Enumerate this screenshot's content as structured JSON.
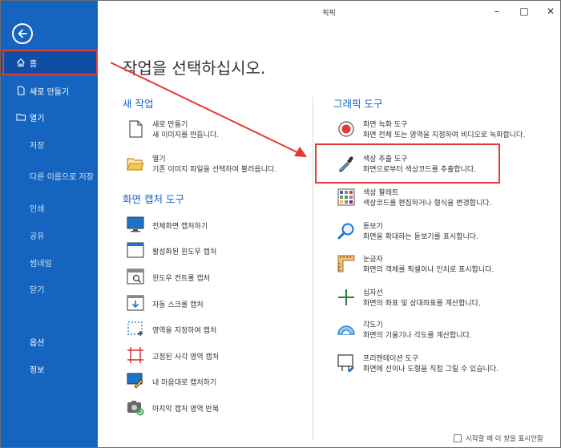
{
  "window": {
    "title": "픽픽",
    "minimize": "–",
    "maximize": "□",
    "close": "✕"
  },
  "sidebar": {
    "items": [
      {
        "label": "홈"
      },
      {
        "label": "새로 만들기"
      },
      {
        "label": "열기"
      },
      {
        "label": "저장"
      },
      {
        "label": "다른 이름으로 저장"
      },
      {
        "label": "인쇄"
      },
      {
        "label": "공유"
      },
      {
        "label": "썸네일"
      },
      {
        "label": "닫기"
      },
      {
        "label": "옵션"
      },
      {
        "label": "정보"
      }
    ]
  },
  "main": {
    "heading": "작업을 선택하십시오.",
    "new_task": {
      "title": "새 작업",
      "items": [
        {
          "title": "새로 만들기",
          "desc": "새 이미지를 만듭니다."
        },
        {
          "title": "열기",
          "desc": "기존 이미지 파일을 선택하여 불러옵니다."
        }
      ]
    },
    "capture": {
      "title": "화면 캡처 도구",
      "items": [
        {
          "title": "전체화면 캡처하기"
        },
        {
          "title": "활성화된 윈도우 캡처"
        },
        {
          "title": "윈도우 컨트롤 캡처"
        },
        {
          "title": "자동 스크롤 캡처"
        },
        {
          "title": "영역을 지정하여 캡처"
        },
        {
          "title": "고정된 사각 영역 캡처"
        },
        {
          "title": "내 마음대로 캡처하기"
        },
        {
          "title": "마지막 캡처 영역 반복"
        }
      ]
    },
    "graphic": {
      "title": "그래픽 도구",
      "items": [
        {
          "title": "화면 녹화 도구",
          "desc": "화면 전체 또는 영역을 지정하여 비디오로 녹화합니다."
        },
        {
          "title": "색상 추출 도구",
          "desc": "화면으로부터 색상코드를 추출합니다."
        },
        {
          "title": "색상 팔레트",
          "desc": "색상코드를 편집하거나 형식을 변경합니다."
        },
        {
          "title": "돋보기",
          "desc": "화면을 확대하는 돋보기를 표시합니다."
        },
        {
          "title": "눈금자",
          "desc": "화면의 객체를 픽셀이나 인치로 표시합니다."
        },
        {
          "title": "십자선",
          "desc": "화면의 좌표 및 상대좌표를 계산합니다."
        },
        {
          "title": "각도기",
          "desc": "화면의 기울기나 각도를 계산합니다."
        },
        {
          "title": "프리젠테이션 도구",
          "desc": "화면에 선이나 도형을 직접 그릴 수 있습니다."
        }
      ]
    }
  },
  "footer": {
    "startup_label": "시작할 때 이 창을 표시안함",
    "checked": false
  },
  "colors": {
    "sidebar": "#1565c0",
    "accent": "#1565c0",
    "highlight": "#e53935"
  }
}
